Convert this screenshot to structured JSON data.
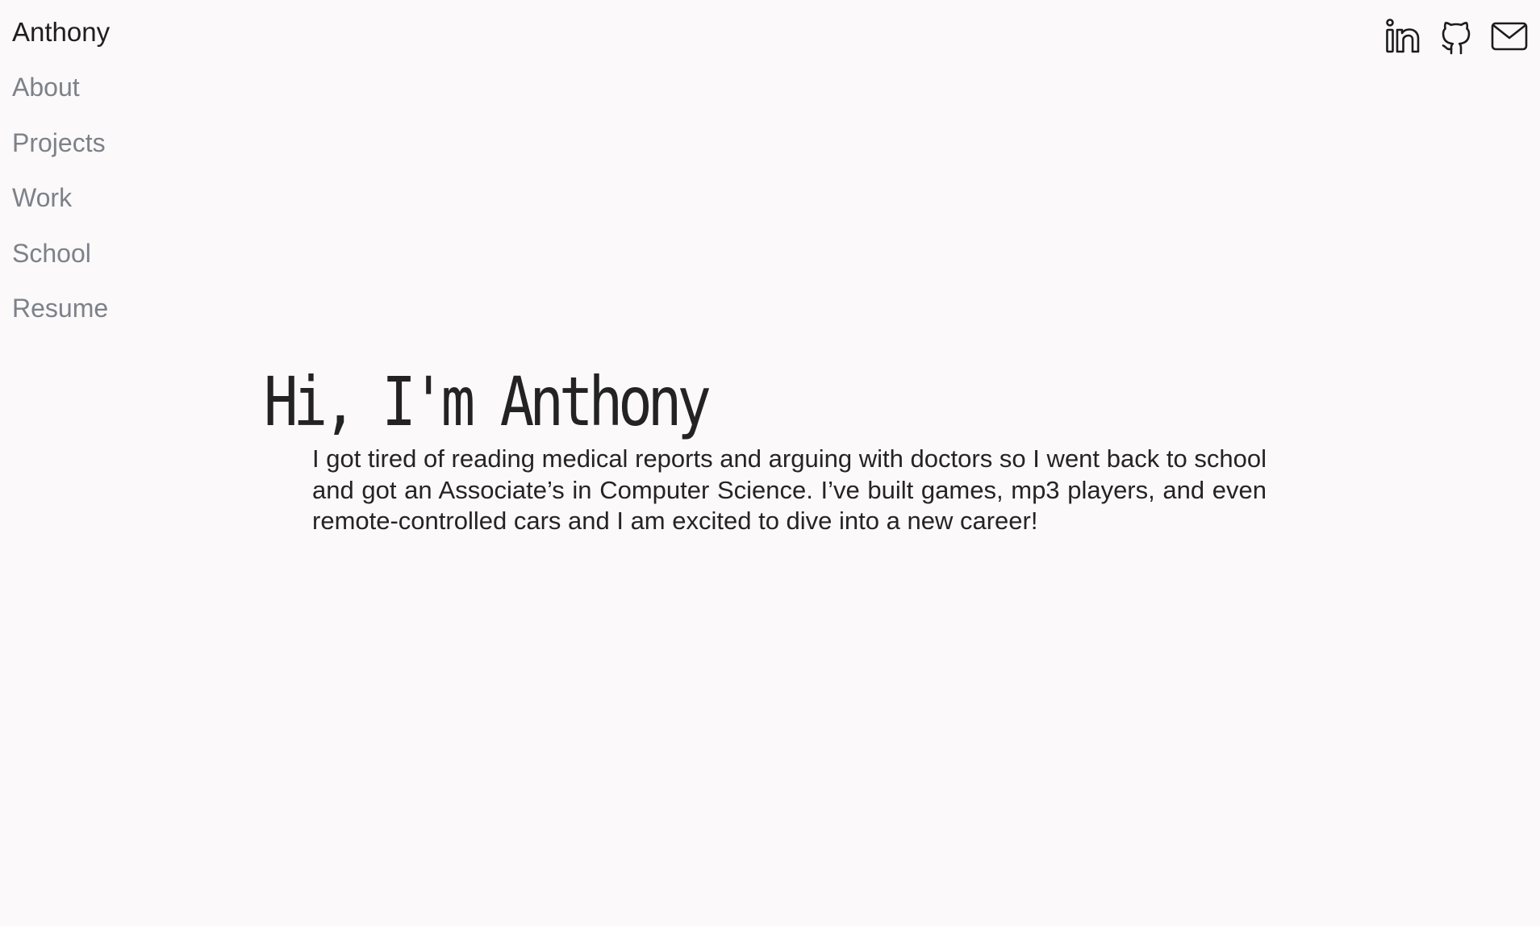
{
  "nav": {
    "brand": "Anthony",
    "items": [
      {
        "label": "About"
      },
      {
        "label": "Projects"
      },
      {
        "label": "Work"
      },
      {
        "label": "School"
      },
      {
        "label": "Resume"
      }
    ]
  },
  "social": {
    "icons": [
      "linkedin-icon",
      "github-icon",
      "mail-icon"
    ]
  },
  "hero": {
    "title": "Hi, I'm Anthony",
    "text": "I got tired of reading medical reports and arguing with doctors so I went back to school and got an Associate’s in Computer Science. I’ve built games, mp3 players, and even remote-controlled cars and I am excited to dive into a new career!"
  },
  "colors": {
    "background": "#fbf9f9",
    "nav_text": "#7d818a",
    "brand_text": "#1f1f1f",
    "body_text": "#242424"
  }
}
